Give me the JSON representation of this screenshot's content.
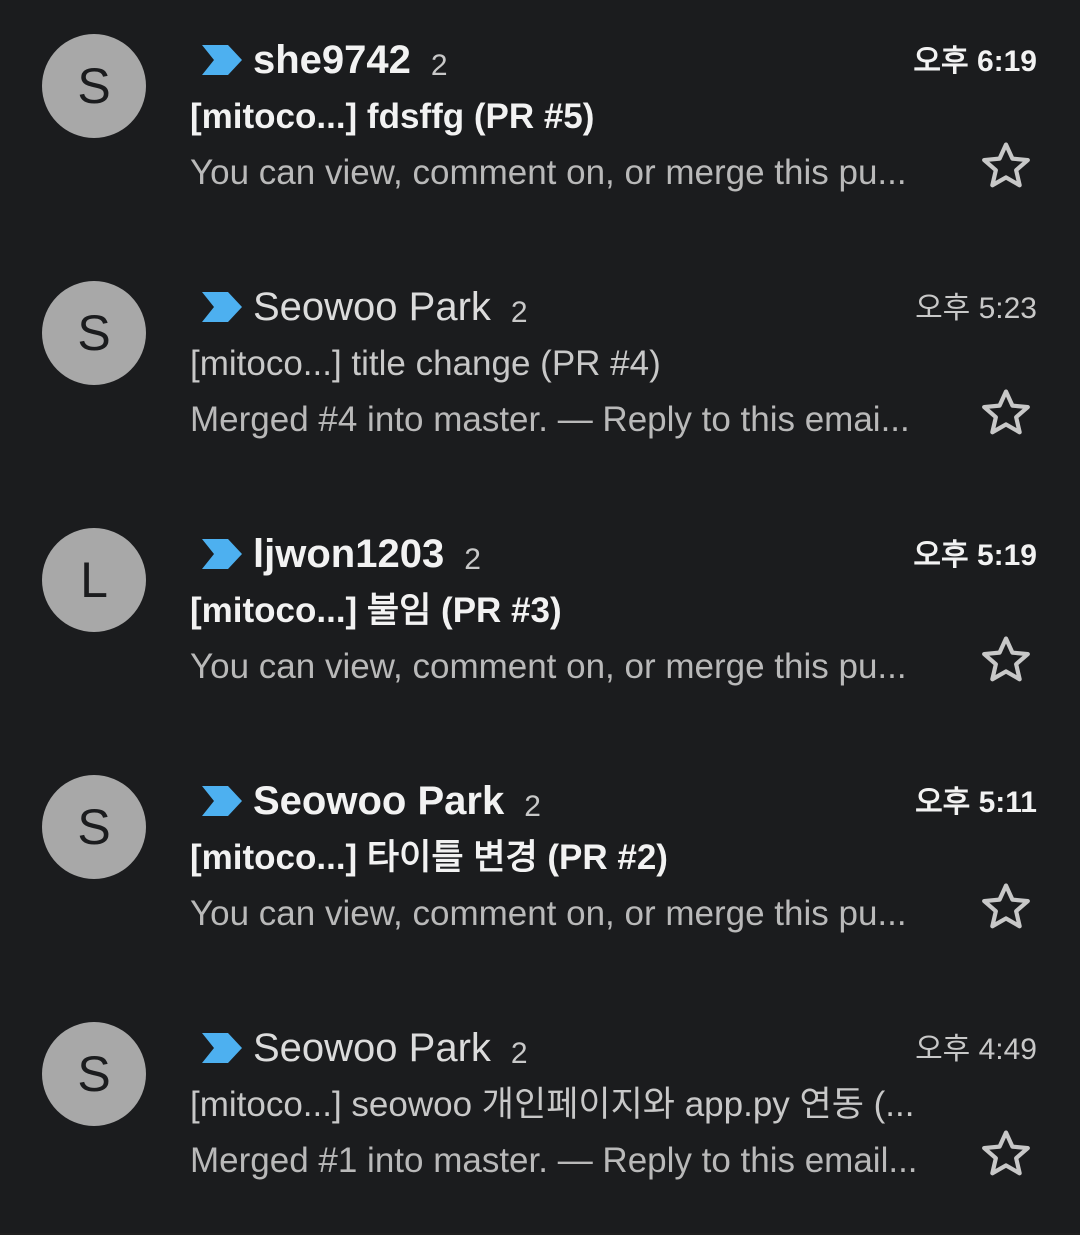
{
  "colors": {
    "background": "#1b1c1e",
    "avatar": "#a8a8a8",
    "importance_marker": "#4db0f0",
    "star_outline": "#c8c8c8"
  },
  "icons": {
    "importance": "importance-marker-icon",
    "star": "star-outline-icon"
  },
  "emails": [
    {
      "avatar_letter": "S",
      "sender": "she9742",
      "count": "2",
      "time": "오후 6:19",
      "subject": "[mitoco...] fdsffg (PR #5)",
      "snippet": "You can view, comment on, or merge this pu...",
      "unread": true,
      "starred": false
    },
    {
      "avatar_letter": "S",
      "sender": "Seowoo Park",
      "count": "2",
      "time": "오후 5:23",
      "subject": "[mitoco...] title change (PR #4)",
      "snippet": "Merged #4 into master. — Reply to this emai...",
      "unread": false,
      "starred": false
    },
    {
      "avatar_letter": "L",
      "sender": "ljwon1203",
      "count": "2",
      "time": "오후 5:19",
      "subject": "[mitoco...] 불임 (PR #3)",
      "snippet": "You can view, comment on, or merge this pu...",
      "unread": true,
      "starred": false
    },
    {
      "avatar_letter": "S",
      "sender": "Seowoo Park",
      "count": "2",
      "time": "오후 5:11",
      "subject": "[mitoco...] 타이틀 변경 (PR #2)",
      "snippet": "You can view, comment on, or merge this pu...",
      "unread": true,
      "starred": false
    },
    {
      "avatar_letter": "S",
      "sender": "Seowoo Park",
      "count": "2",
      "time": "오후 4:49",
      "subject": "[mitoco...] seowoo 개인페이지와 app.py 연동 (...",
      "snippet": "Merged #1 into master. — Reply to this email...",
      "unread": false,
      "starred": false
    }
  ]
}
